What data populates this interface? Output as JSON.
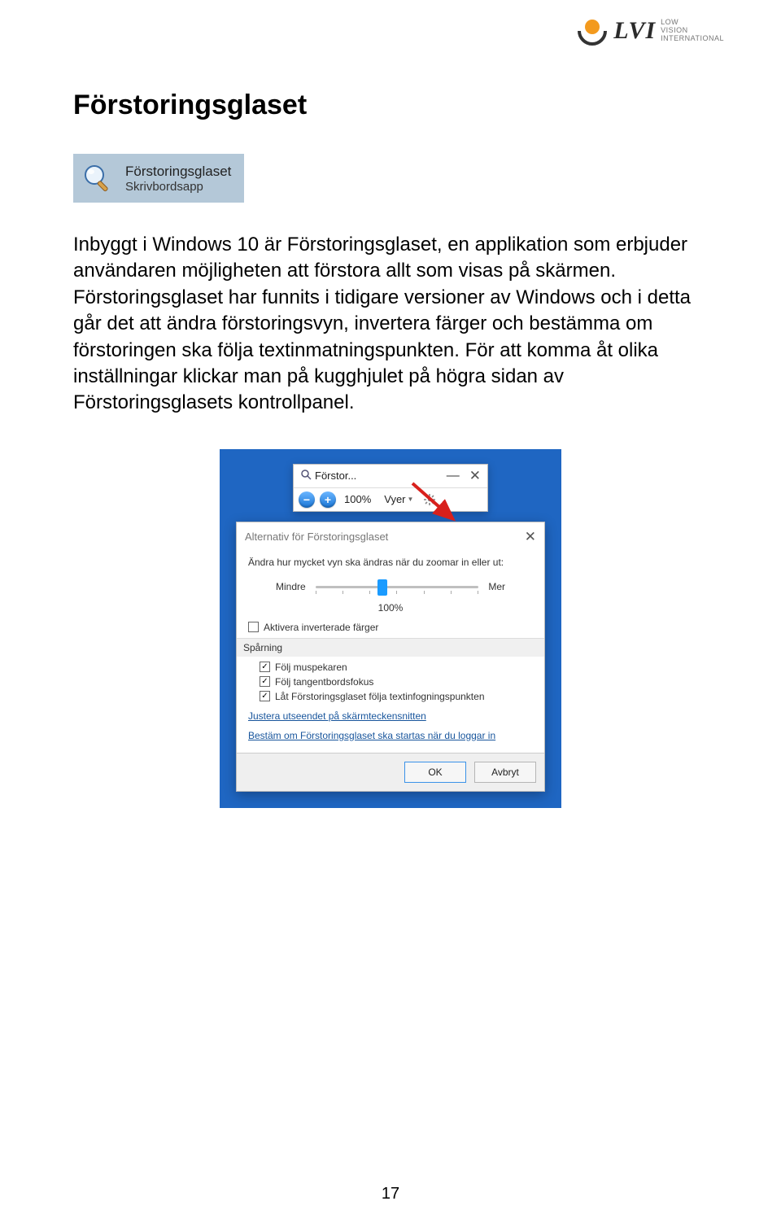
{
  "logo": {
    "main": "LVI",
    "sub_line1": "LOW",
    "sub_line2": "VISION",
    "sub_line3": "INTERNATIONAL"
  },
  "heading": "Förstoringsglaset",
  "app_tile": {
    "title": "Förstoringsglaset",
    "subtitle": "Skrivbordsapp"
  },
  "body": "Inbyggt i Windows 10 är Förstoringsglaset, en applikation som erbjuder användaren möjligheten att förstora allt som visas på skärmen. Förstoringsglaset har funnits i tidigare versioner av Windows och i detta går det att ändra förstoringsvyn, invertera färger och bestämma om förstoringen ska följa textinmatningspunkten. För att komma åt olika inställningar klickar man på kugghjulet på högra sidan av Förstoringsglasets kontrollpanel.",
  "magnifier_bar": {
    "title": "Förstor...",
    "zoom": "100%",
    "views": "Vyer"
  },
  "options": {
    "dialog_title": "Alternativ för Förstoringsglaset",
    "instruction": "Ändra hur mycket vyn ska ändras när du zoomar in eller ut:",
    "slider_min": "Mindre",
    "slider_max": "Mer",
    "slider_value": "100%",
    "invert": "Aktivera inverterade färger",
    "tracking_header": "Spårning",
    "follow_mouse": "Följ muspekaren",
    "follow_keyboard": "Följ tangentbordsfokus",
    "follow_text": "Låt Förstoringsglaset följa textinfogningspunkten",
    "link_appearance": "Justera utseendet på skärmteckensnitten",
    "link_startup": "Bestäm om Förstoringsglaset ska startas när du loggar in",
    "ok": "OK",
    "cancel": "Avbryt"
  },
  "page_number": "17"
}
